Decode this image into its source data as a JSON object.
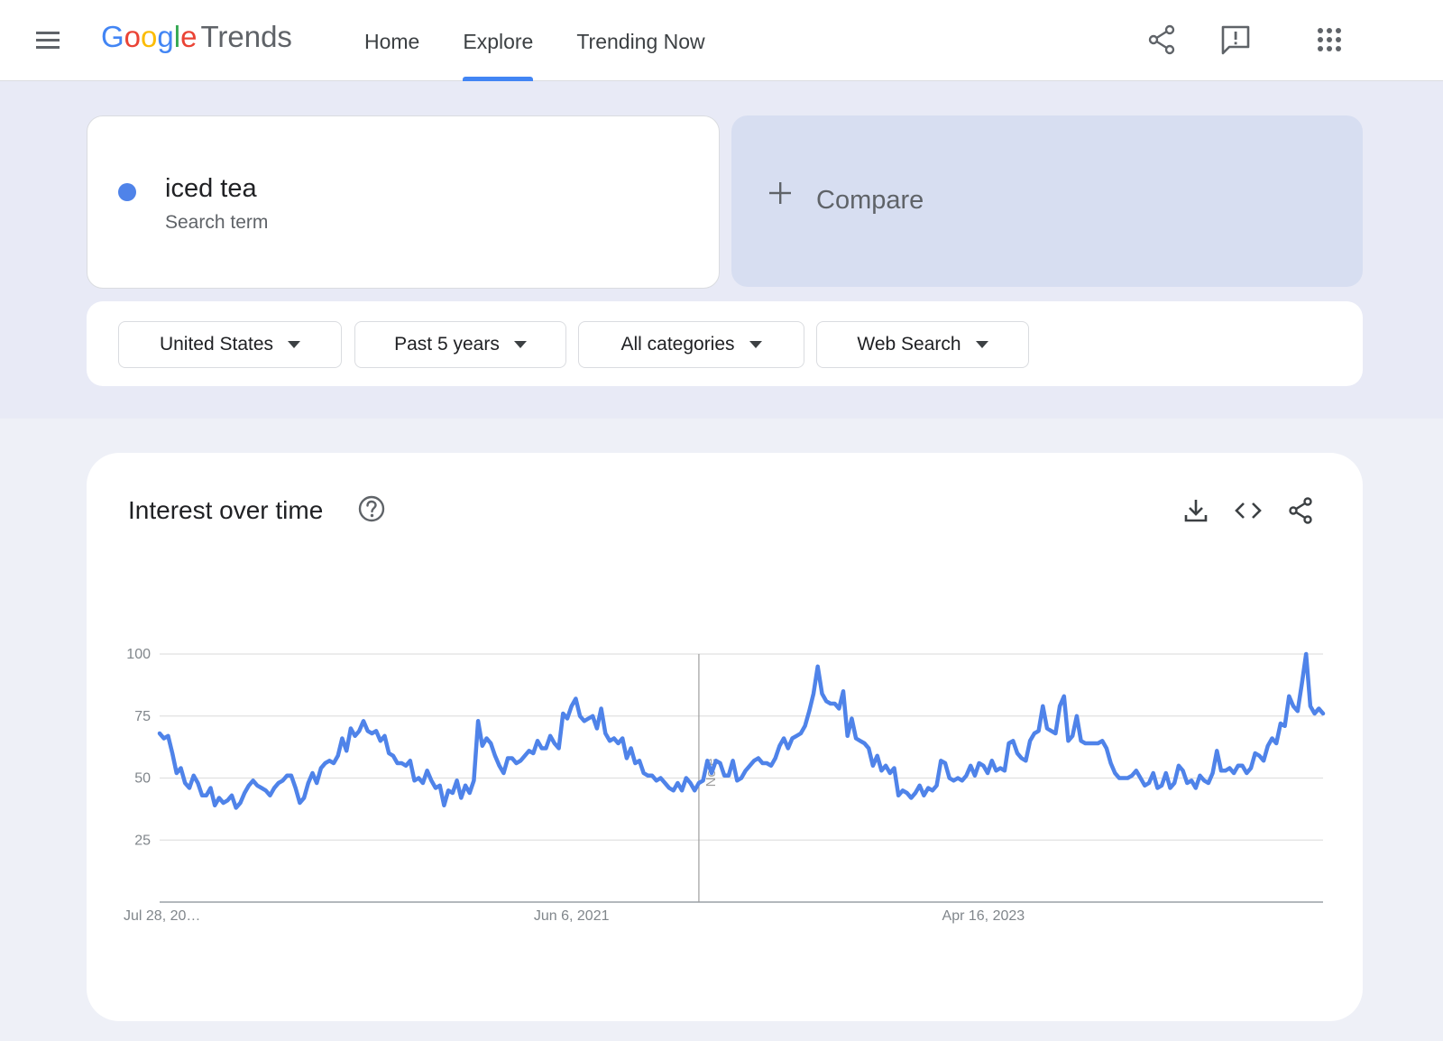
{
  "header": {
    "logo_google": [
      "G",
      "o",
      "o",
      "g",
      "l",
      "e"
    ],
    "logo_product": "Trends",
    "nav": [
      {
        "label": "Home",
        "active": false
      },
      {
        "label": "Explore",
        "active": true
      },
      {
        "label": "Trending Now",
        "active": false
      }
    ],
    "icons": [
      "menu-icon",
      "share-icon",
      "feedback-icon",
      "apps-icon"
    ]
  },
  "search": {
    "term": "iced tea",
    "term_type": "Search term",
    "term_color": "#4f83e9",
    "compare_label": "Compare"
  },
  "filters": [
    {
      "label": "United States"
    },
    {
      "label": "Past 5 years"
    },
    {
      "label": "All categories"
    },
    {
      "label": "Web Search"
    }
  ],
  "chart_card": {
    "title": "Interest over time",
    "icons": [
      "help-icon",
      "download-icon",
      "embed-icon",
      "share-icon"
    ]
  },
  "chart_data": {
    "type": "line",
    "title": "Interest over time",
    "xlabel": "",
    "ylabel": "",
    "ylim": [
      0,
      100
    ],
    "yticks": [
      25,
      50,
      75,
      100
    ],
    "x_tick_labels": [
      "Jul 28, 20…",
      "Jun 6, 2021",
      "Apr 16, 2023"
    ],
    "x_tick_weeks": [
      0,
      97,
      194
    ],
    "note_marker": {
      "label": "Note",
      "week": 127
    },
    "grid": true,
    "line_color": "#4f83e9",
    "series": [
      {
        "name": "iced tea",
        "values": [
          68,
          66,
          67,
          60,
          52,
          54,
          48,
          46,
          51,
          48,
          43,
          43,
          46,
          39,
          42,
          40,
          41,
          43,
          38,
          40,
          44,
          47,
          49,
          47,
          46,
          45,
          43,
          46,
          48,
          49,
          51,
          51,
          46,
          40,
          42,
          48,
          52,
          48,
          54,
          56,
          57,
          56,
          59,
          66,
          61,
          70,
          67,
          69,
          73,
          69,
          68,
          69,
          65,
          67,
          60,
          59,
          56,
          56,
          55,
          57,
          49,
          50,
          48,
          53,
          49,
          46,
          47,
          39,
          45,
          44,
          49,
          42,
          47,
          44,
          49,
          73,
          63,
          66,
          64,
          59,
          55,
          52,
          58,
          58,
          56,
          57,
          59,
          61,
          60,
          65,
          62,
          62,
          67,
          64,
          62,
          76,
          74,
          79,
          82,
          75,
          73,
          74,
          75,
          70,
          78,
          68,
          65,
          66,
          64,
          66,
          58,
          62,
          56,
          57,
          52,
          51,
          51,
          49,
          50,
          48,
          46,
          45,
          48,
          45,
          50,
          48,
          45,
          48,
          49,
          57,
          52,
          57,
          56,
          51,
          51,
          57,
          49,
          50,
          53,
          55,
          57,
          58,
          56,
          56,
          55,
          58,
          63,
          66,
          62,
          66,
          67,
          68,
          71,
          77,
          84,
          95,
          84,
          81,
          80,
          80,
          78,
          85,
          67,
          74,
          66,
          65,
          64,
          62,
          55,
          59,
          53,
          55,
          52,
          54,
          43,
          45,
          44,
          42,
          44,
          47,
          43,
          46,
          45,
          47,
          57,
          56,
          50,
          49,
          50,
          49,
          51,
          55,
          51,
          56,
          55,
          52,
          57,
          53,
          54,
          53,
          64,
          65,
          60,
          58,
          57,
          65,
          68,
          69,
          79,
          70,
          69,
          68,
          79,
          83,
          65,
          67,
          75,
          65,
          64,
          64,
          64,
          64,
          65,
          62,
          56,
          52,
          50,
          50,
          50,
          51,
          53,
          50,
          47,
          48,
          52,
          46,
          47,
          52,
          46,
          48,
          55,
          53,
          48,
          49,
          46,
          51,
          49,
          48,
          52,
          61,
          53,
          53,
          54,
          52,
          55,
          55,
          52,
          54,
          60,
          59,
          57,
          63,
          66,
          64,
          72,
          71,
          83,
          79,
          77,
          88,
          100,
          79,
          76,
          78,
          76
        ]
      }
    ]
  }
}
